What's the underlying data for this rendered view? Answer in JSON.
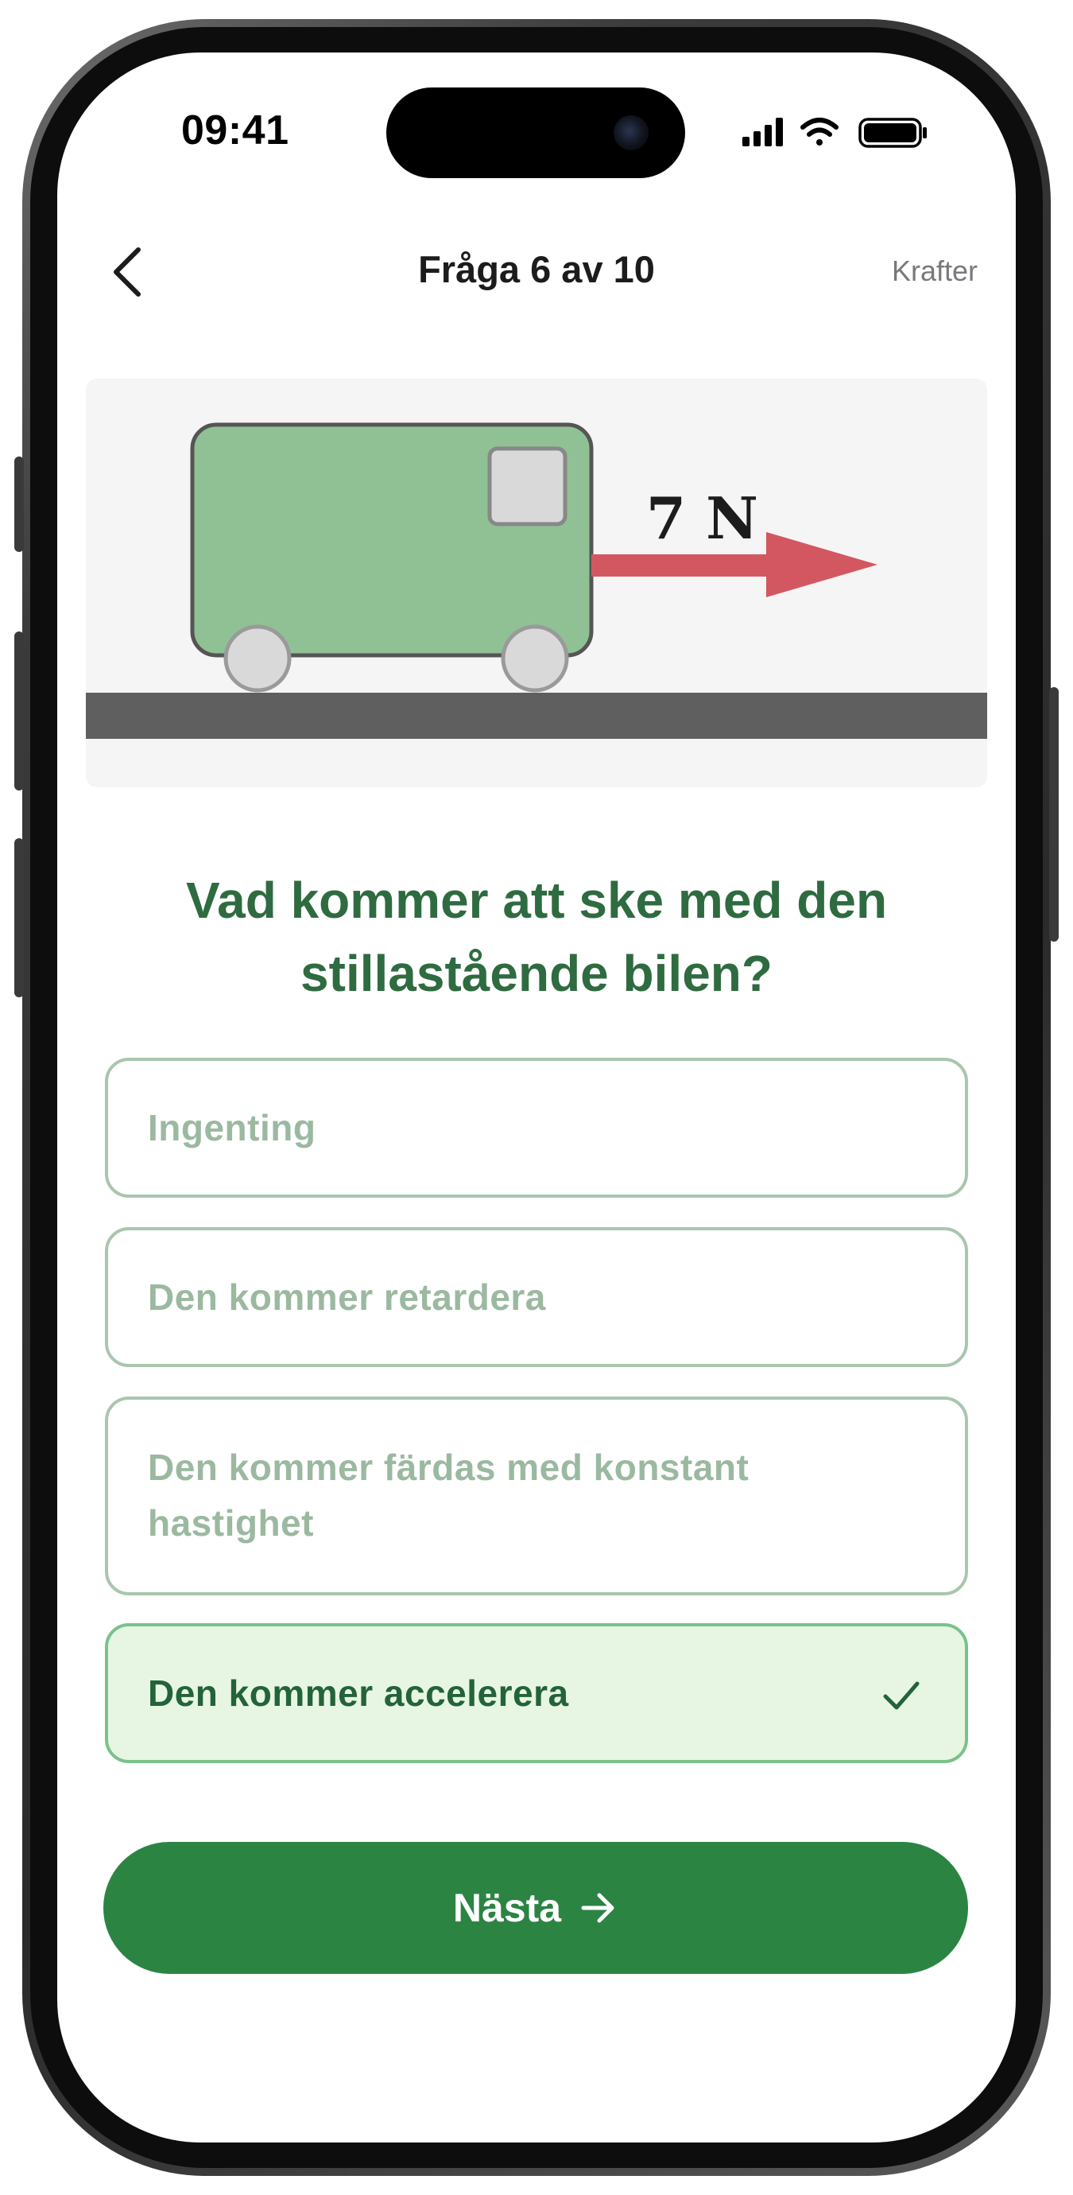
{
  "status_bar": {
    "time": "09:41"
  },
  "nav": {
    "back_icon": "chevron-left-icon",
    "title": "Fråga 6 av 10",
    "topic": "Krafter"
  },
  "illustration": {
    "force_label": "7 N",
    "colors": {
      "car_body": "#8fc195",
      "force_arrow": "#d35761",
      "ground": "#5f5f5f"
    }
  },
  "question": {
    "text": "Vad kommer att ske med den stillastående bilen?"
  },
  "options": [
    {
      "label": "Ingenting",
      "selected": false
    },
    {
      "label": "Den kommer retardera",
      "selected": false
    },
    {
      "label": "Den kommer färdas med konstant hastighet",
      "selected": false
    },
    {
      "label": "Den kommer accelerera",
      "selected": true
    }
  ],
  "next_button": {
    "label": "Nästa",
    "icon": "arrow-right-icon"
  },
  "colors": {
    "accent": "#2c8443",
    "question_text": "#2f6b40",
    "selected_bg": "#e7f6e2",
    "option_border": "#a9c6ae"
  }
}
